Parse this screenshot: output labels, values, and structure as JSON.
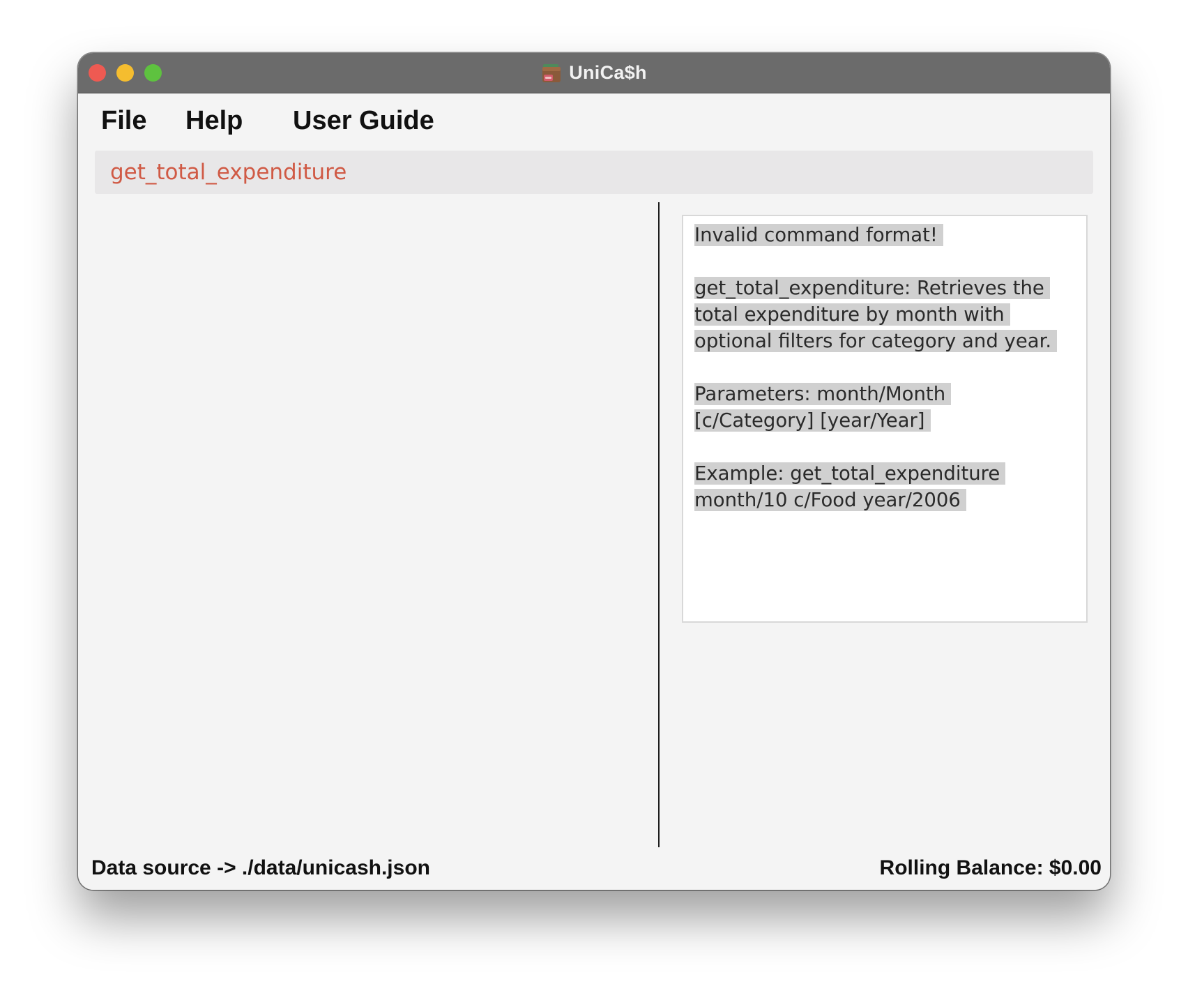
{
  "window": {
    "title": "UniCa$h",
    "app_icon": "wallet-icon"
  },
  "menu": {
    "items": [
      {
        "label": "File"
      },
      {
        "label": "Help"
      },
      {
        "label": "User Guide"
      }
    ]
  },
  "command_box": {
    "value": "get_total_expenditure",
    "text_color": "#d05a45"
  },
  "result_display": {
    "paragraphs": [
      "Invalid command format!",
      "get_total_expenditure: Retrieves the total expenditure by month with optional filters for category and year.",
      "Parameters: month/Month [c/Category] [year/Year]",
      "Example: get_total_expenditure month/10 c/Food year/2006"
    ]
  },
  "status_bar": {
    "data_source": "Data source -> ./data/unicash.json",
    "rolling_balance": "Rolling Balance: $0.00"
  },
  "colors": {
    "titlebar": "#6b6b6b",
    "traffic_close": "#ee5a52",
    "traffic_minimize": "#f5bd2f",
    "traffic_zoom": "#5ec23f",
    "command_box_bg": "#e8e7e8",
    "result_highlight": "#d0d0d0"
  }
}
